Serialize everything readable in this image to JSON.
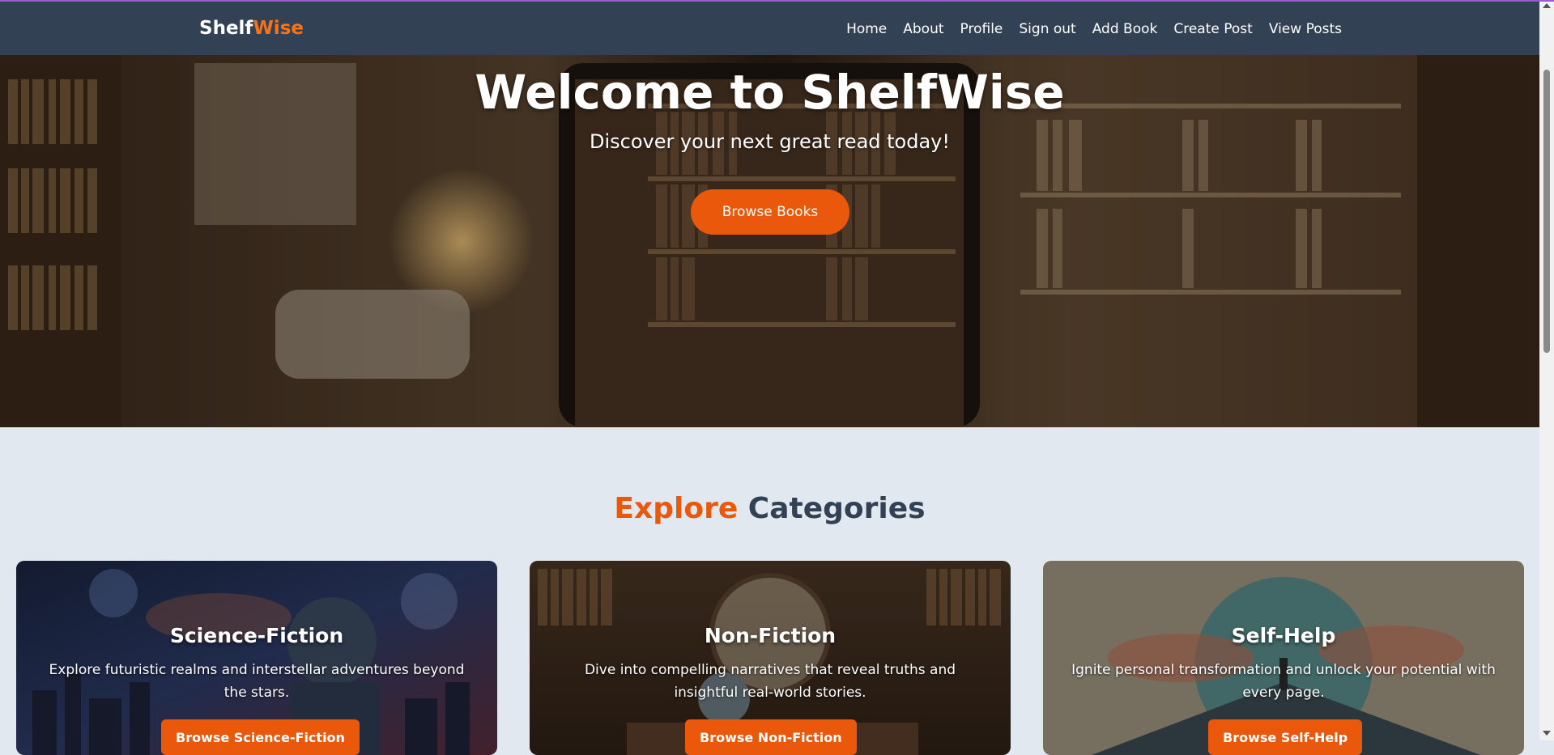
{
  "brand": {
    "part1": "Shelf",
    "part2": "Wise"
  },
  "nav": {
    "items": [
      "Home",
      "About",
      "Profile",
      "Sign out",
      "Add Book",
      "Create Post",
      "View Posts"
    ]
  },
  "hero": {
    "title": "Welcome to ShelfWise",
    "subtitle": "Discover your next great read today!",
    "button": "Browse Books"
  },
  "categories": {
    "title_part1": "Explore",
    "title_part2": "Categories",
    "cards": [
      {
        "title": "Science-Fiction",
        "description": "Explore futuristic realms and interstellar adventures beyond the stars.",
        "button": "Browse Science-Fiction"
      },
      {
        "title": "Non-Fiction",
        "description": "Dive into compelling narratives that reveal truths and insightful real-world stories.",
        "button": "Browse Non-Fiction"
      },
      {
        "title": "Self-Help",
        "description": "Ignite personal transformation and unlock your potential with every page.",
        "button": "Browse Self-Help"
      }
    ]
  },
  "colors": {
    "navbar": "#334155",
    "accent": "#ea580c",
    "page_bg": "#e2e8f0"
  }
}
